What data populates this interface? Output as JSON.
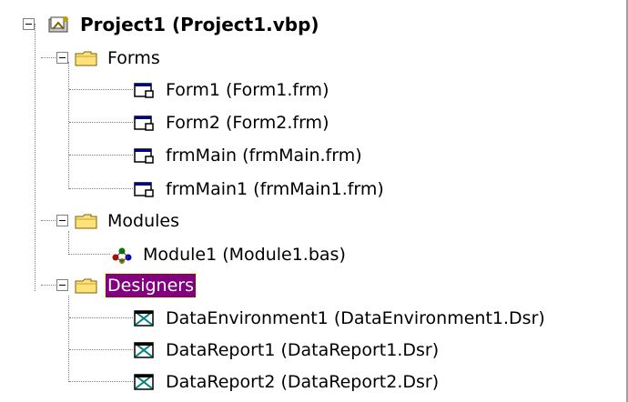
{
  "project": {
    "label": "Project1 (Project1.vbp)",
    "icon": "project-icon"
  },
  "folders": [
    {
      "label": "Forms",
      "icon": "folder-icon",
      "items": [
        {
          "label": "Form1 (Form1.frm)",
          "icon": "form-icon"
        },
        {
          "label": "Form2 (Form2.frm)",
          "icon": "form-icon"
        },
        {
          "label": "frmMain (frmMain.frm)",
          "icon": "form-icon"
        },
        {
          "label": "frmMain1 (frmMain1.frm)",
          "icon": "form-icon"
        }
      ]
    },
    {
      "label": "Modules",
      "icon": "folder-icon",
      "items": [
        {
          "label": "Module1 (Module1.bas)",
          "icon": "module-icon"
        }
      ]
    },
    {
      "label": "Designers",
      "icon": "folder-icon",
      "selected": true,
      "items": [
        {
          "label": "DataEnvironment1 (DataEnvironment1.Dsr)",
          "icon": "designer-icon"
        },
        {
          "label": "DataReport1 (DataReport1.Dsr)",
          "icon": "designer-icon"
        },
        {
          "label": "DataReport2 (DataReport2.Dsr)",
          "icon": "designer-icon"
        }
      ]
    }
  ],
  "colors": {
    "selection_bg": "#800080",
    "selection_fg": "#ffffff",
    "tree_lines": "#808080"
  }
}
